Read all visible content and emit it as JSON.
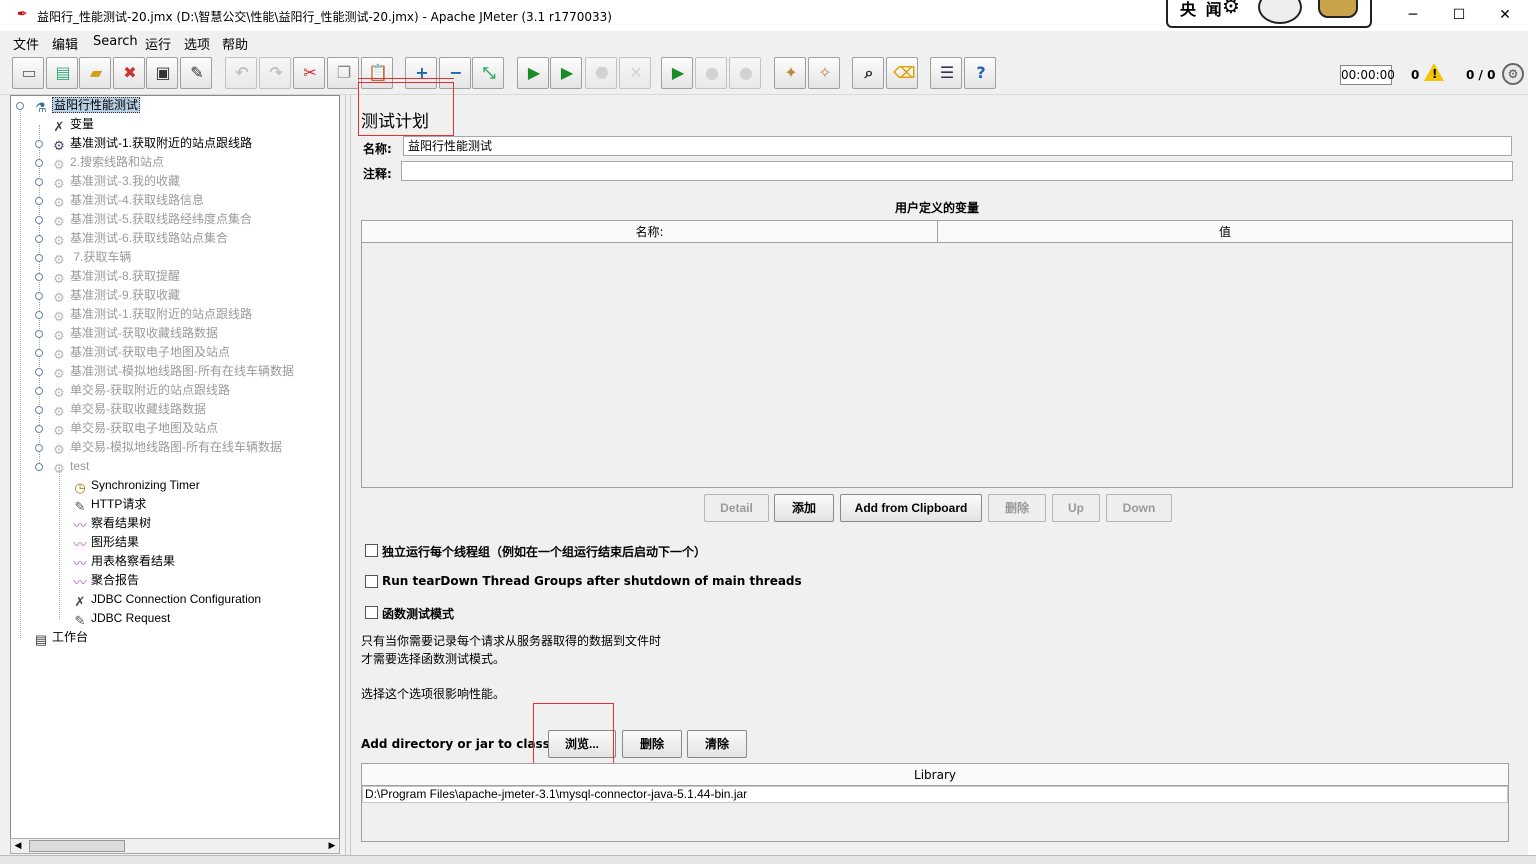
{
  "window": {
    "title": "益阳行_性能测试-20.jmx (D:\\智慧公交\\性能\\益阳行_性能测试-20.jmx) - Apache JMeter (3.1 r1770033)",
    "overlay_text": "央 闻",
    "minimize": "─",
    "maximize": "☐",
    "close": "✕"
  },
  "menu": [
    "文件",
    "编辑",
    "Search",
    "运行",
    "选项",
    "帮助"
  ],
  "toolbar": {
    "buttons": [
      {
        "name": "new-icon",
        "glyph": "▭"
      },
      {
        "name": "templates-icon",
        "glyph": "▤"
      },
      {
        "name": "open-icon",
        "glyph": "▰"
      },
      {
        "name": "close-file-icon",
        "glyph": "✖"
      },
      {
        "name": "save-icon",
        "glyph": "▣"
      },
      {
        "name": "save-screenshot-icon",
        "glyph": "✎"
      },
      {
        "name": "undo-icon",
        "glyph": "↶"
      },
      {
        "name": "redo-icon",
        "glyph": "↷"
      },
      {
        "name": "cut-icon",
        "glyph": "✂"
      },
      {
        "name": "copy-icon",
        "glyph": "❐"
      },
      {
        "name": "paste-icon",
        "glyph": "📋"
      },
      {
        "name": "expand-all-icon",
        "glyph": "+"
      },
      {
        "name": "collapse-all-icon",
        "glyph": "−"
      },
      {
        "name": "toggle-icon",
        "glyph": "⤡"
      },
      {
        "name": "start-icon",
        "glyph": "▶"
      },
      {
        "name": "start-no-pause-icon",
        "glyph": "▶"
      },
      {
        "name": "stop-icon",
        "glyph": "⬣"
      },
      {
        "name": "shutdown-icon",
        "glyph": "✕"
      },
      {
        "name": "remote-start-icon",
        "glyph": "▶"
      },
      {
        "name": "remote-stop-icon",
        "glyph": "●"
      },
      {
        "name": "remote-shutdown-icon",
        "glyph": "●"
      },
      {
        "name": "clear-icon",
        "glyph": "✦"
      },
      {
        "name": "clear-all-icon",
        "glyph": "✧"
      },
      {
        "name": "search-icon",
        "glyph": "⌕"
      },
      {
        "name": "reset-search-icon",
        "glyph": "⌫"
      },
      {
        "name": "function-helper-icon",
        "glyph": "☰"
      },
      {
        "name": "help-icon",
        "glyph": "?"
      }
    ],
    "timer": "00:00:00",
    "errors": "0",
    "threads": "0 / 0"
  },
  "tree": {
    "nodes": [
      {
        "label": "益阳行性能测试",
        "icon": "testplan-icon",
        "depth": 0,
        "disabled": false,
        "selected": true
      },
      {
        "label": "变量",
        "icon": "config-icon",
        "depth": 1,
        "disabled": false,
        "selected": false
      },
      {
        "label": "基准测试-1.获取附近的站点跟线路",
        "icon": "threadgroup-icon",
        "depth": 1,
        "disabled": false,
        "selected": false
      },
      {
        "label": "2.搜索线路和站点",
        "icon": "threadgroup-icon",
        "depth": 1,
        "disabled": true,
        "selected": false
      },
      {
        "label": "基准测试-3.我的收藏",
        "icon": "threadgroup-icon",
        "depth": 1,
        "disabled": true,
        "selected": false
      },
      {
        "label": "基准测试-4.获取线路信息",
        "icon": "threadgroup-icon",
        "depth": 1,
        "disabled": true,
        "selected": false
      },
      {
        "label": "基准测试-5.获取线路经纬度点集合",
        "icon": "threadgroup-icon",
        "depth": 1,
        "disabled": true,
        "selected": false
      },
      {
        "label": "基准测试-6.获取线路站点集合",
        "icon": "threadgroup-icon",
        "depth": 1,
        "disabled": true,
        "selected": false
      },
      {
        "label": " 7.获取车辆",
        "icon": "threadgroup-icon",
        "depth": 1,
        "disabled": true,
        "selected": false
      },
      {
        "label": "基准测试-8.获取提醒",
        "icon": "threadgroup-icon",
        "depth": 1,
        "disabled": true,
        "selected": false
      },
      {
        "label": "基准测试-9.获取收藏",
        "icon": "threadgroup-icon",
        "depth": 1,
        "disabled": true,
        "selected": false
      },
      {
        "label": "基准测试-1.获取附近的站点跟线路",
        "icon": "threadgroup-icon",
        "depth": 1,
        "disabled": true,
        "selected": false
      },
      {
        "label": "基准测试-获取收藏线路数据",
        "icon": "threadgroup-icon",
        "depth": 1,
        "disabled": true,
        "selected": false
      },
      {
        "label": "基准测试-获取电子地图及站点",
        "icon": "threadgroup-icon",
        "depth": 1,
        "disabled": true,
        "selected": false
      },
      {
        "label": "基准测试-模拟地线路图-所有在线车辆数据",
        "icon": "threadgroup-icon",
        "depth": 1,
        "disabled": true,
        "selected": false
      },
      {
        "label": "单交易-获取附近的站点跟线路",
        "icon": "threadgroup-icon",
        "depth": 1,
        "disabled": true,
        "selected": false
      },
      {
        "label": "单交易-获取收藏线路数据",
        "icon": "threadgroup-icon",
        "depth": 1,
        "disabled": true,
        "selected": false
      },
      {
        "label": "单交易-获取电子地图及站点",
        "icon": "threadgroup-icon",
        "depth": 1,
        "disabled": true,
        "selected": false
      },
      {
        "label": "单交易-模拟地线路图-所有在线车辆数据",
        "icon": "threadgroup-icon",
        "depth": 1,
        "disabled": true,
        "selected": false
      },
      {
        "label": "test",
        "icon": "threadgroup-icon",
        "depth": 1,
        "disabled": true,
        "selected": false
      },
      {
        "label": "Synchronizing Timer",
        "icon": "timer-icon",
        "depth": 2,
        "disabled": false,
        "selected": false
      },
      {
        "label": "HTTP请求",
        "icon": "sampler-icon",
        "depth": 2,
        "disabled": false,
        "selected": false
      },
      {
        "label": "察看结果树",
        "icon": "listener-icon",
        "depth": 2,
        "disabled": false,
        "selected": false
      },
      {
        "label": "图形结果",
        "icon": "listener-icon",
        "depth": 2,
        "disabled": false,
        "selected": false
      },
      {
        "label": "用表格察看结果",
        "icon": "listener-icon",
        "depth": 2,
        "disabled": false,
        "selected": false
      },
      {
        "label": "聚合报告",
        "icon": "listener-icon",
        "depth": 2,
        "disabled": false,
        "selected": false
      },
      {
        "label": "JDBC Connection Configuration",
        "icon": "config-icon",
        "depth": 2,
        "disabled": false,
        "selected": false
      },
      {
        "label": "JDBC Request",
        "icon": "sampler-icon",
        "depth": 2,
        "disabled": false,
        "selected": false
      },
      {
        "label": "工作台",
        "icon": "workbench-icon",
        "depth": 0,
        "disabled": false,
        "selected": false
      }
    ]
  },
  "main": {
    "title": "测试计划",
    "name_label": "名称:",
    "name_value": "益阳行性能测试",
    "comment_label": "注释:",
    "comment_value": "",
    "vars_title": "用户定义的变量",
    "vars_columns": [
      "名称:",
      "值"
    ],
    "vars_buttons": [
      {
        "label": "Detail",
        "disabled": true
      },
      {
        "label": "添加",
        "disabled": false
      },
      {
        "label": "Add from Clipboard",
        "disabled": false
      },
      {
        "label": "删除",
        "disabled": true
      },
      {
        "label": "Up",
        "disabled": true
      },
      {
        "label": "Down",
        "disabled": true
      }
    ],
    "checkboxes": [
      {
        "label": "独立运行每个线程组（例如在一个组运行结束后启动下一个）",
        "checked": false
      },
      {
        "label": "Run tearDown Thread Groups after shutdown of main threads",
        "checked": false
      },
      {
        "label": "函数测试模式",
        "checked": false
      }
    ],
    "note_line1": "只有当你需要记录每个请求从服务器取得的数据到文件时",
    "note_line2": "才需要选择函数测试模式。",
    "note_line3": "选择这个选项很影响性能。",
    "classpath_label": "Add directory or jar to classpath",
    "classpath_buttons": [
      "浏览...",
      "删除",
      "清除"
    ],
    "library_header": "Library",
    "library_rows": [
      "D:\\Program Files\\apache-jmeter-3.1\\mysql-connector-java-5.1.44-bin.jar"
    ]
  },
  "colors": {
    "annotation_red": "#e03030",
    "selection": "#b8cfe5",
    "disabled_text": "#9a9a9a"
  }
}
